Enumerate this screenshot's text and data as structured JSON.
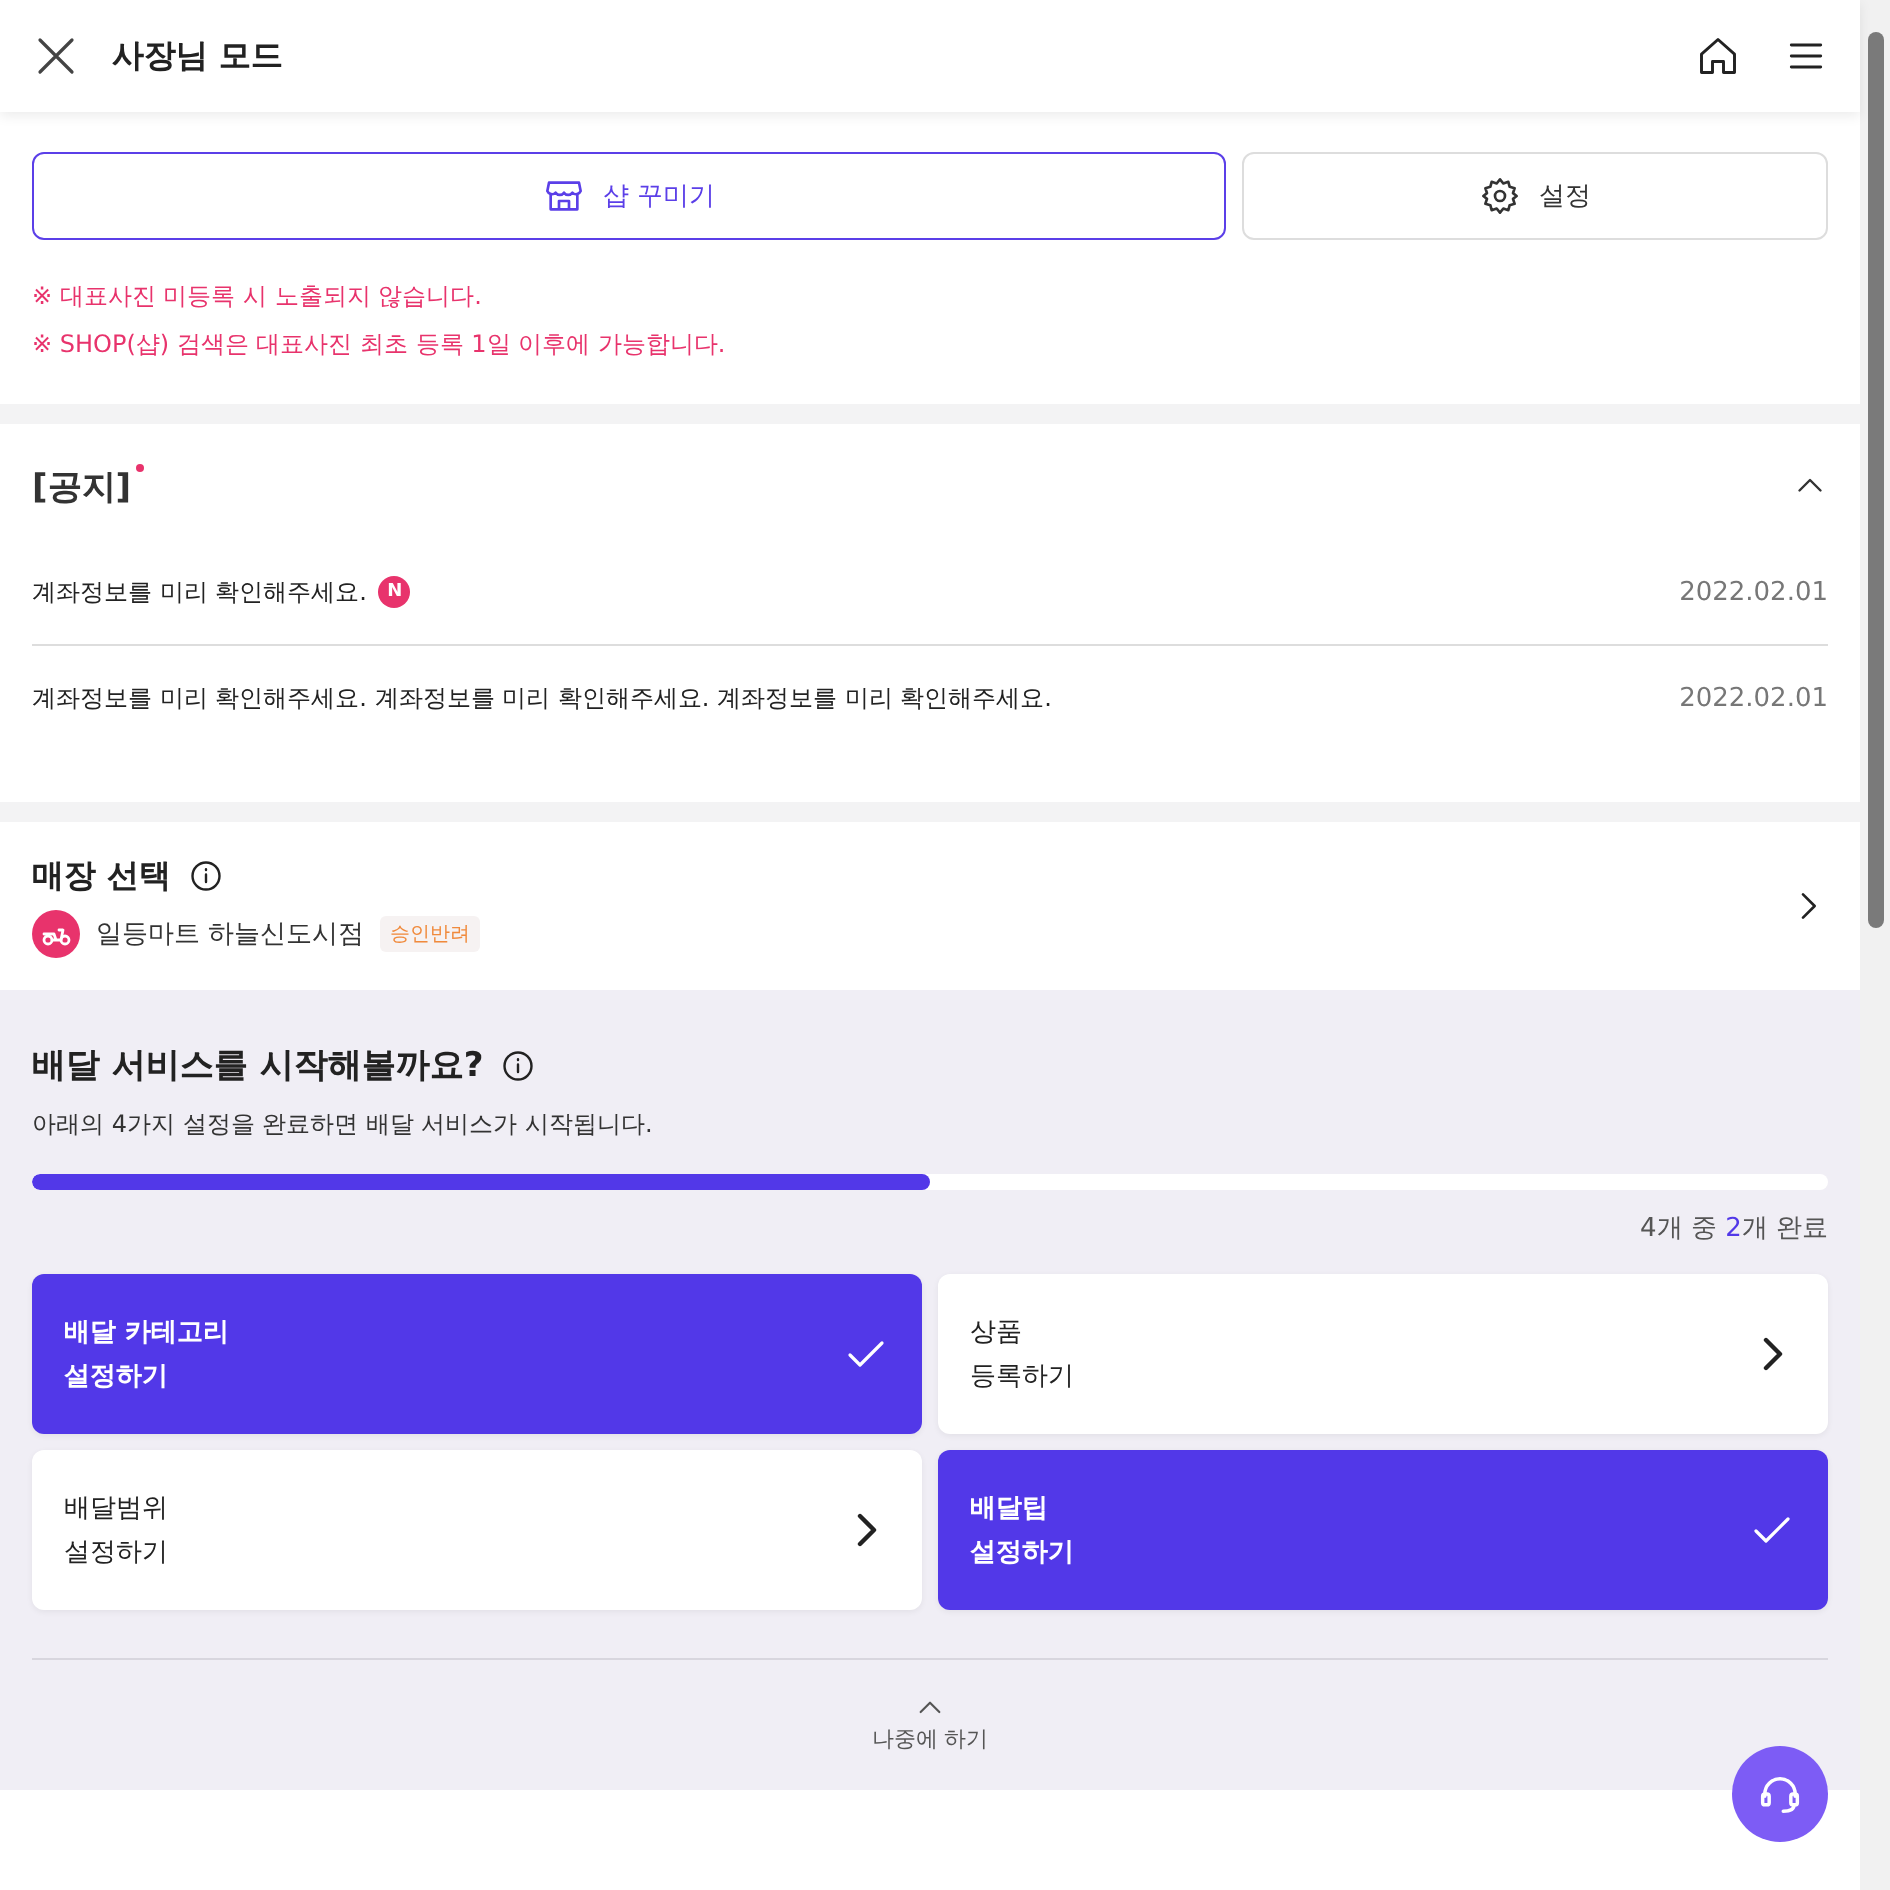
{
  "header": {
    "title": "사장님 모드"
  },
  "shop_buttons": [
    {
      "kind": "shop",
      "label": "샵 꾸미기",
      "selected": true
    },
    {
      "kind": "settings",
      "label": "설정",
      "selected": false
    }
  ],
  "notes": [
    "※ 대표사진 미등록 시 노출되지 않습니다.",
    "※ SHOP(샵) 검색은 대표사진 최초 등록 1일 이후에 가능합니다."
  ],
  "notice": {
    "title": "[공지]",
    "unread": true,
    "expanded": true,
    "items": [
      {
        "text": "계좌정보를 미리 확인해주세요.",
        "badge": "N",
        "date": "2022.02.01"
      },
      {
        "text": "계좌정보를 미리 확인해주세요. 계좌정보를 미리 확인해주세요. 계좌정보를 미리 확인해주세요.",
        "date": "2022.02.01"
      }
    ]
  },
  "store": {
    "title": "매장 선택",
    "name": "일등마트 하늘신도시점",
    "status": "승인반려"
  },
  "delivery": {
    "title": "배달 서비스를 시작해볼까요?",
    "subtitle": "아래의 4가지 설정을 완료하면 배달 서비스가 시작됩니다.",
    "level": 0.5,
    "progress": {
      "prefix": "4개 중 ",
      "count": "2",
      "suffix": "개 완료"
    },
    "steps": [
      {
        "lines": [
          "배달 카테고리",
          "설정하기"
        ],
        "done": true
      },
      {
        "lines": [
          "상품",
          "등록하기"
        ],
        "done": false
      },
      {
        "lines": [
          "배달범위",
          "설정하기"
        ],
        "done": false
      },
      {
        "lines": [
          "배달팁",
          "설정하기"
        ],
        "done": true
      }
    ],
    "later": "나중에 하기"
  }
}
